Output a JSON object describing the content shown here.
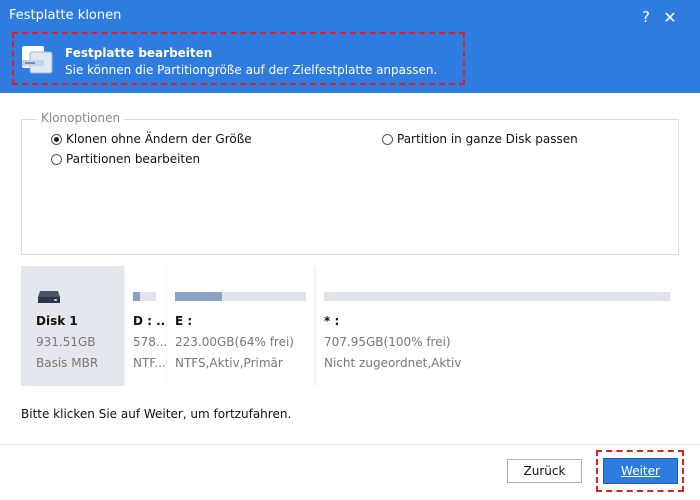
{
  "window": {
    "title": "Festplatte klonen",
    "help_glyph": "?",
    "close_glyph": "✕"
  },
  "header": {
    "heading": "Festplatte bearbeiten",
    "description": "Sie können die Partitiongröße auf der Zielfestplatte anpassen."
  },
  "clone_options": {
    "legend": "Klonoptionen",
    "options": [
      {
        "label": "Klonen ohne Ändern der Größe",
        "selected": true
      },
      {
        "label": "Partitionen bearbeiten",
        "selected": false
      },
      {
        "label": "Partition in ganze Disk passen",
        "selected": false
      }
    ]
  },
  "disk": {
    "name": "Disk 1",
    "size": "931.51GB",
    "type": "Basis MBR",
    "partitions": [
      {
        "label": "D : ...",
        "size": "578...",
        "fs": "NTF...",
        "used_fraction": 0.3
      },
      {
        "label": "E :",
        "size": "223.00GB(64% frei)",
        "fs": "NTFS,Aktiv,Primär",
        "used_fraction": 0.36
      },
      {
        "label": "* :",
        "size": "707.95GB(100% frei)",
        "fs": "Nicht zugeordnet,Aktiv",
        "used_fraction": 0.0
      }
    ]
  },
  "hint": "Bitte klicken Sie auf Weiter, um fortzufahren.",
  "buttons": {
    "back": "Zurück",
    "next": "Weiter"
  },
  "colors": {
    "header": "#2f7ce0",
    "accent_button": "#2f7ce0",
    "highlight_outline": "#e02020",
    "used_bar": "#8aa3c4"
  }
}
